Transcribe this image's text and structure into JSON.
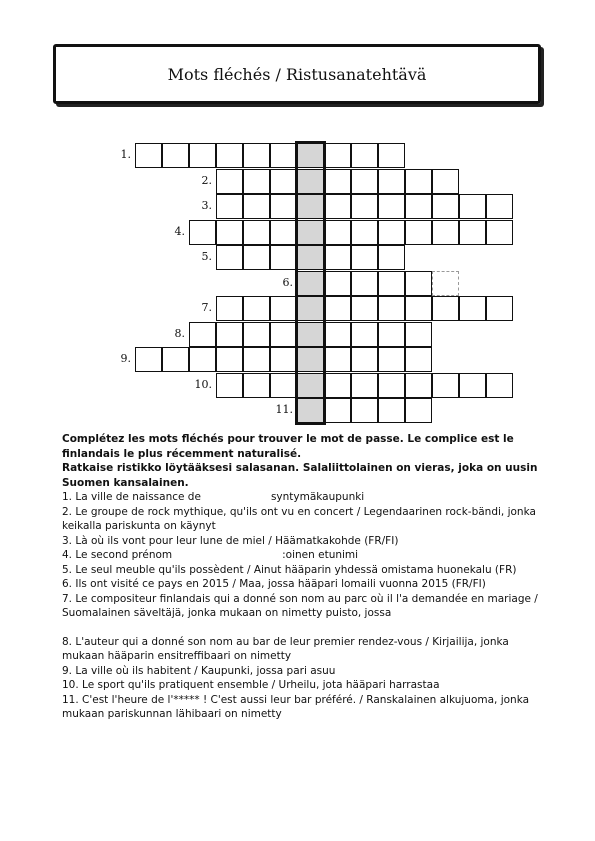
{
  "title": "Mots fléchés / Ristusanatehtävä",
  "rows": [
    {
      "num": "1.",
      "start": 0,
      "len": 10
    },
    {
      "num": "2.",
      "start": 3,
      "len": 9
    },
    {
      "num": "3.",
      "start": 3,
      "len": 11
    },
    {
      "num": "4.",
      "start": 2,
      "len": 12
    },
    {
      "num": "5.",
      "start": 3,
      "len": 7
    },
    {
      "num": "6.",
      "start": 6,
      "len": 6
    },
    {
      "num": "7.",
      "start": 3,
      "len": 11
    },
    {
      "num": "8.",
      "start": 2,
      "len": 9
    },
    {
      "num": "9.",
      "start": 0,
      "len": 11
    },
    {
      "num": "10.",
      "start": 3,
      "len": 11
    },
    {
      "num": "11.",
      "start": 6,
      "len": 5
    }
  ],
  "intro_fr": "Complétez les mots fléchés pour trouver le mot de passe. Le complice est le finlandais le plus récemment naturalisé.",
  "intro_fi": "Ratkaise ristikko löytääksesi salasanan. Salaliittolainen on vieras, joka on uusin Suomen kansalainen.",
  "clues": {
    "c1a": "1. La ville de naissance de",
    "c1b": "syntymäkaupunki",
    "c2": "2. Le groupe de rock mythique, qu'ils ont vu en concert / Legendaarinen rock-bändi, jonka keikalla pariskunta on käynyt",
    "c3": "3. Là où ils vont pour leur lune de miel / Häämatkakohde (FR/FI)",
    "c4a": "4. Le second prénom",
    "c4b": ":oinen etunimi",
    "c5": "5. Le seul meuble qu'ils possèdent / Ainut hääparin yhdessä omistama huonekalu (FR)",
    "c6": "6. Ils ont visité ce pays en 2015 / Maa, jossa hääpari lomaili vuonna 2015 (FR/FI)",
    "c7": "7. Le compositeur finlandais qui a donné son nom au parc où il l'a demandée en mariage / Suomalainen säveltäjä, jonka mukaan on nimetty puisto, jossa",
    "c8": "8. L'auteur qui a donné son nom au bar de leur premier rendez-vous / Kirjailija, jonka mukaan hääparin ensitreffibaari on nimetty",
    "c9": "9. La ville où ils habitent / Kaupunki, jossa pari asuu",
    "c10": "10. Le sport qu'ils pratiquent ensemble / Urheilu, jota hääpari harrastaa",
    "c11": "11. C'est l'heure de l'***** ! C'est aussi leur bar préféré. / Ranskalainen alkujuoma, jonka mukaan pariskunnan lähibaari on nimetty"
  }
}
